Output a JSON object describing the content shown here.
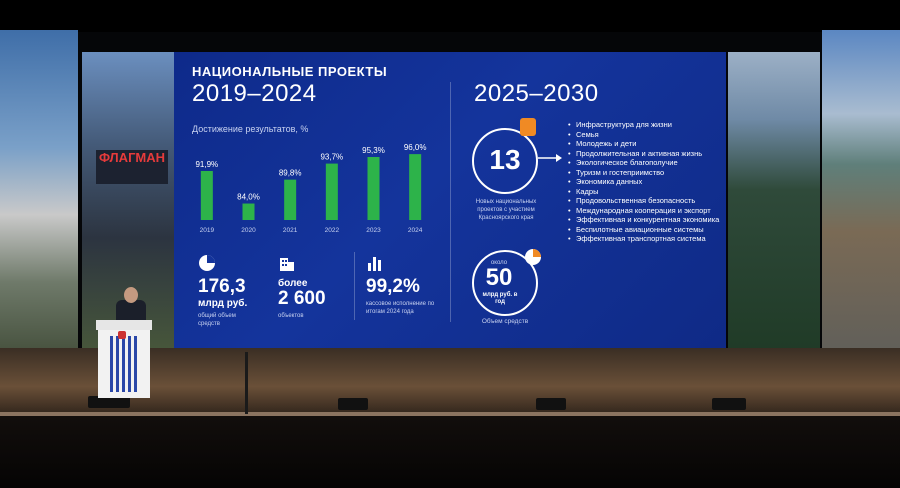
{
  "slide": {
    "title": "НАЦИОНАЛЬНЫЕ ПРОЕКТЫ",
    "period_past": "2019–2024",
    "period_future": "2025–2030",
    "achievement_label": "Достижение результатов, %",
    "stats": [
      {
        "value": "176,3",
        "unit": "млрд руб.",
        "note": "общий объем средств",
        "icon": "pie-chart-icon"
      },
      {
        "value_prefix": "более",
        "value": "2 600",
        "note": "объектов",
        "icon": "buildings-icon"
      },
      {
        "value": "99,2%",
        "note": "кассовое исполнение по итогам 2024 года",
        "icon": "bar-chart-icon"
      }
    ],
    "future": {
      "projects_count": "13",
      "projects_note": "Новых национальных проектов с участием Красноярского края",
      "funding_prefix": "около",
      "funding_value": "50",
      "funding_unit": "млрд руб. в год",
      "funding_note": "Объем средств",
      "projects": [
        "Инфраструктура для жизни",
        "Семья",
        "Молодежь и дети",
        "Продолжительная и активная жизнь",
        "Экологическое благополучие",
        "Туризм и гостеприимство",
        "Экономика данных",
        "Кадры",
        "Продовольственная безопасность",
        "Международная кооперация и экспорт",
        "Эффективная и конкурентная экономика",
        "Беспилотные авиационные системы",
        "Эффективная транспортная система"
      ]
    }
  },
  "building_sign": "ФЛАГМАН",
  "colors": {
    "screen_blue": "#14349c",
    "bar_green": "#2db34a",
    "accent_orange": "#f08a24"
  },
  "chart_data": {
    "type": "bar",
    "categories": [
      "2019",
      "2020",
      "2021",
      "2022",
      "2023",
      "2024"
    ],
    "values": [
      91.9,
      84.0,
      89.8,
      93.7,
      95.3,
      96.0
    ],
    "data_labels": [
      "91,9%",
      "84,0%",
      "89,8%",
      "93,7%",
      "95,3%",
      "96,0%"
    ],
    "title": "Достижение результатов, %",
    "ylim": [
      80,
      97
    ]
  }
}
